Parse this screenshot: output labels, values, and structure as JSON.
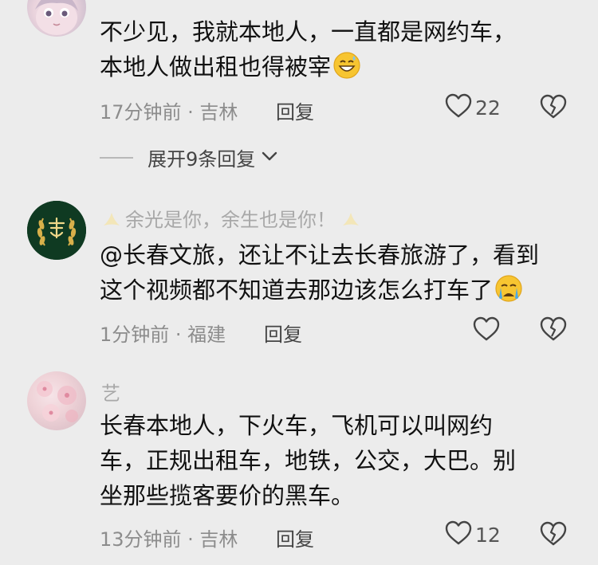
{
  "comments": [
    {
      "lines": [
        "不少见，我就本地人，一直都是网约车，",
        "本地人做出租也得被宰"
      ],
      "emoji": "grinning-sweat-emoji",
      "time_location": "17分钟前 · 吉林",
      "reply_label": "回复",
      "likes": "22"
    },
    {
      "username": "余光是你，余生也是你！",
      "lines": [
        "@长春文旅，还让不让去长春旅游了，看到",
        "这个视频都不知道去那边该怎么打车了"
      ],
      "emoji": "crying-emoji",
      "time_location": "1分钟前 · 福建",
      "reply_label": "回复",
      "likes": ""
    },
    {
      "username": "艺",
      "lines": [
        "长春本地人，下火车，飞机可以叫网约",
        "车，正规出租车，地铁，公交，大巴。别",
        "坐那些揽客要价的黑车。"
      ],
      "time_location": "13分钟前 · 吉林",
      "reply_label": "回复",
      "likes": "12"
    }
  ],
  "expand_replies": "展开9条回复",
  "colors": {
    "background": "#ececec",
    "text": "#111111",
    "meta": "#8c8c8c",
    "username": "#a8a8a8",
    "avatar_green": "#0f3a22",
    "avatar_gold": "#d8b04a"
  }
}
